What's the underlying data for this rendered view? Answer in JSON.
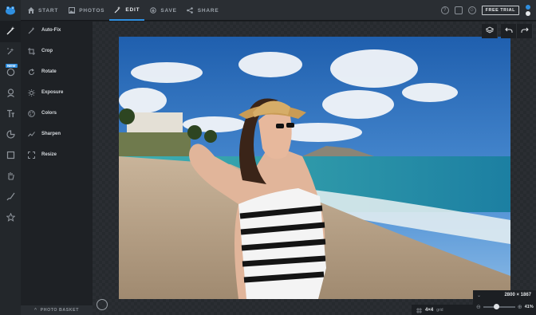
{
  "topnav": {
    "items": [
      {
        "label": "START",
        "icon": "home-icon"
      },
      {
        "label": "PHOTOS",
        "icon": "image-icon"
      },
      {
        "label": "EDIT",
        "icon": "magic-wand-icon",
        "active": true
      },
      {
        "label": "SAVE",
        "icon": "save-icon"
      },
      {
        "label": "SHARE",
        "icon": "share-icon"
      }
    ],
    "free_trial": "FREE TRIAL"
  },
  "rail": {
    "new_badge": "NEW"
  },
  "tools": [
    {
      "label": "Auto-Fix",
      "icon": "auto-fix-icon"
    },
    {
      "label": "Crop",
      "icon": "crop-icon"
    },
    {
      "label": "Rotate",
      "icon": "rotate-icon"
    },
    {
      "label": "Exposure",
      "icon": "exposure-icon"
    },
    {
      "label": "Colors",
      "icon": "colors-icon"
    },
    {
      "label": "Sharpen",
      "icon": "sharpen-icon"
    },
    {
      "label": "Resize",
      "icon": "resize-icon"
    }
  ],
  "basket": {
    "label": "PHOTO BASKET"
  },
  "canvas": {
    "dimensions": "2800 × 1867",
    "zoom_percent": "41%",
    "zoom_fraction": 0.41,
    "grid_value": "4×4",
    "grid_label": "grid"
  },
  "colors": {
    "accent": "#2f8fe0",
    "background": "#1b1e22",
    "panel": "#1e2125"
  }
}
